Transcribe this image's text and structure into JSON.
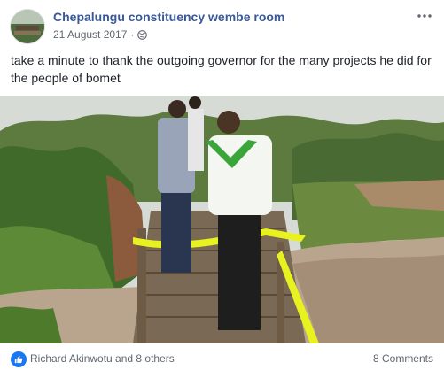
{
  "post": {
    "page_name": "Chepalungu constituency wembe room",
    "date": "21 August 2017",
    "separator": "·",
    "privacy_icon": "globe-icon",
    "more_icon": "more-options-icon",
    "text": "take a minute to thank the outgoing governor for the many projects he did for the people of bomet"
  },
  "footer": {
    "reaction_icon": "like-icon",
    "likers": "Richard Akinwotu and 8 others",
    "comments": "8 Comments"
  },
  "colors": {
    "link": "#385898",
    "like_blue": "#1877f2",
    "ribbon_yellow": "#e8f21e"
  }
}
